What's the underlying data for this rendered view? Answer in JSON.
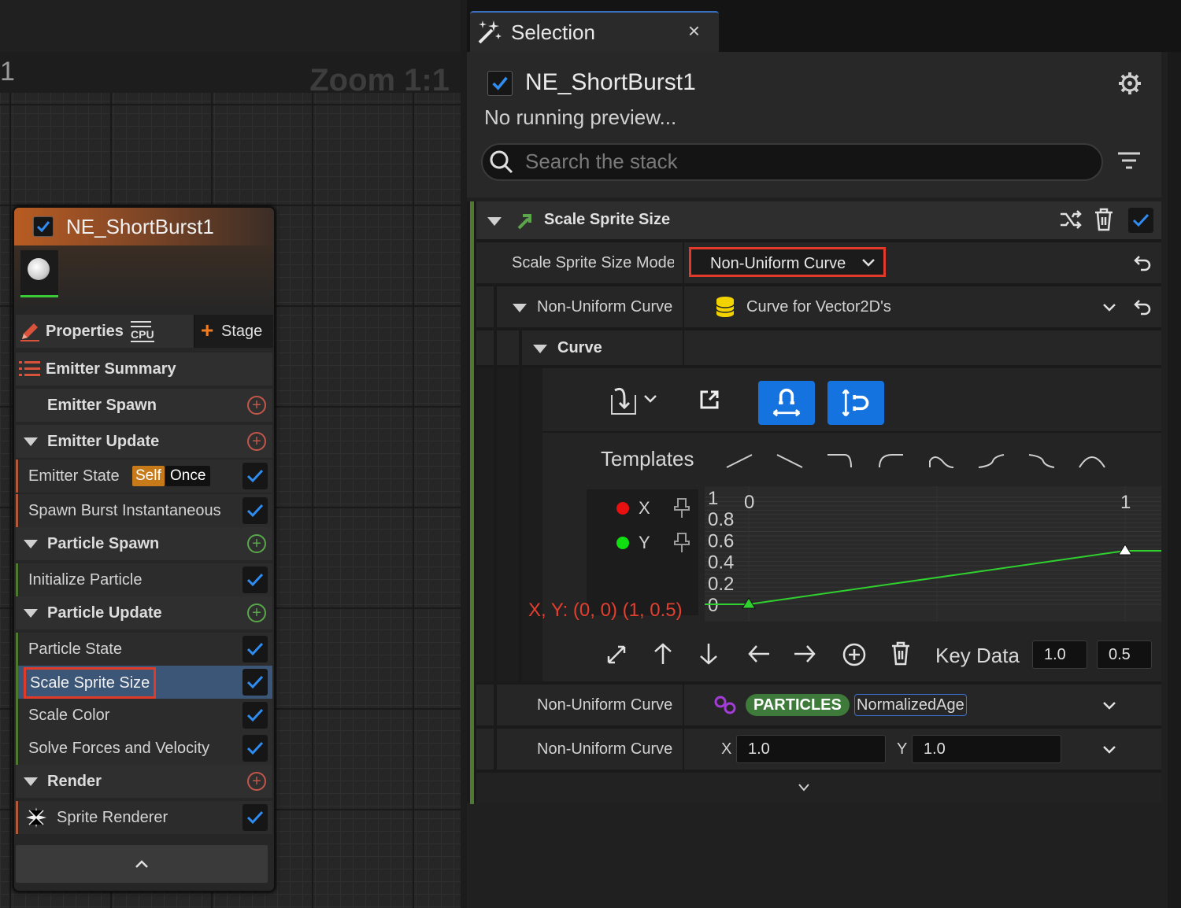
{
  "graph": {
    "zoom_label": "Zoom 1:1",
    "edge_number": "1"
  },
  "node": {
    "title": "NE_ShortBurst1",
    "properties_label": "Properties",
    "cpu_badge": "CPU",
    "stage_button": "Stage",
    "emitter_summary": "Emitter Summary",
    "emitter_spawn": "Emitter Spawn",
    "emitter_update": "Emitter Update",
    "emitter_state": "Emitter State",
    "self_tag": "Self",
    "once_tag": "Once",
    "spawn_burst": "Spawn Burst Instantaneous",
    "particle_spawn": "Particle Spawn",
    "initialize_particle": "Initialize Particle",
    "particle_update": "Particle Update",
    "particle_state": "Particle State",
    "scale_sprite_size": "Scale Sprite Size",
    "scale_color": "Scale Color",
    "solve_forces": "Solve Forces and Velocity",
    "render": "Render",
    "sprite_renderer": "Sprite Renderer"
  },
  "tab": {
    "title": "Selection",
    "close": "×"
  },
  "panel": {
    "emitter_name": "NE_ShortBurst1",
    "preview_status": "No running preview...",
    "search_placeholder": "Search the stack",
    "module_title": "Scale Sprite Size",
    "mode_label": "Scale Sprite Size Mode",
    "mode_value": "Non-Uniform Curve",
    "nu_curve_label": "Non-Uniform Curve",
    "curve_asset": "Curve for Vector2D's",
    "curve_label": "Curve",
    "templates_label": "Templates",
    "channel_x": "X",
    "channel_y": "Y",
    "key_readout": "X, Y: (0, 0) (1, 0.5)",
    "key_data_label": "Key Data",
    "key_data_x": "1.0",
    "key_data_y": "0.5",
    "nu_curve_label_2": "Non-Uniform Curve",
    "particles_tag": "PARTICLES",
    "normalized_age": "NormalizedAge",
    "nu_curve_label_3": "Non-Uniform Curve",
    "x_label": "X",
    "x_value": "1.0",
    "y_label": "Y",
    "y_value": "1.0"
  },
  "curve_chart": {
    "y_ticks": [
      "1",
      "0.8",
      "0.6",
      "0.4",
      "0.2",
      "0"
    ],
    "x_ticks": [
      "0",
      "1"
    ],
    "ylim": [
      0,
      1
    ],
    "xlim": [
      0,
      1
    ],
    "keys": [
      {
        "x": 0,
        "y": 0
      },
      {
        "x": 1,
        "y": 0.5
      }
    ],
    "line_color": "#2fd12f"
  },
  "colors": {
    "accent_blue": "#1573e0",
    "highlight_red": "#e23a2a",
    "emitter_plus": "#c2574a",
    "particle_plus": "#58a84a"
  }
}
